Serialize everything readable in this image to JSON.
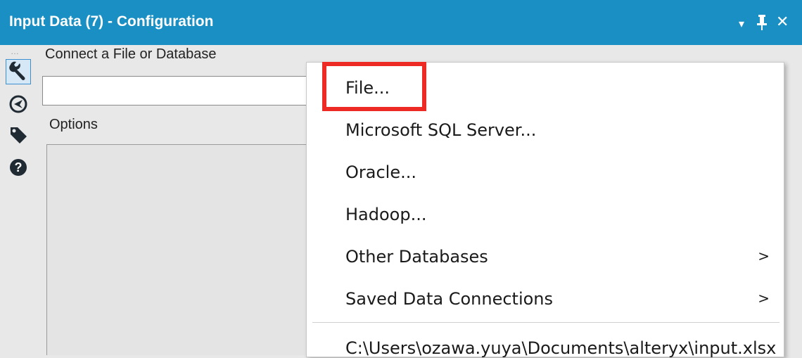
{
  "window": {
    "title": "Input Data (7) - Configuration",
    "controls": {
      "dropdown": "▾",
      "pin": "pin",
      "close": "✕"
    }
  },
  "toolbar": {
    "grip": "…",
    "items": [
      {
        "icon": "wrench-icon",
        "active": true
      },
      {
        "icon": "navigate-icon",
        "active": false
      },
      {
        "icon": "tag-icon",
        "active": false
      },
      {
        "icon": "help-icon",
        "active": false
      }
    ]
  },
  "form": {
    "connect_label": "Connect a File or Database",
    "connect_value": "",
    "options_label": "Options"
  },
  "menu": {
    "items": [
      {
        "label": "File...",
        "submenu": false
      },
      {
        "label": "Microsoft SQL Server...",
        "submenu": false
      },
      {
        "label": "Oracle...",
        "submenu": false
      },
      {
        "label": "Hadoop...",
        "submenu": false
      },
      {
        "label": "Other Databases",
        "submenu": true,
        "arrow": ">"
      },
      {
        "label": "Saved Data Connections",
        "submenu": true,
        "arrow": ">"
      }
    ],
    "recent": "C:\\Users\\ozawa.yuya\\Documents\\alteryx\\input.xlsx"
  },
  "colors": {
    "titlebar": "#1a8fc4",
    "highlight": "#ee2a24",
    "panel": "#e8e8e8"
  }
}
